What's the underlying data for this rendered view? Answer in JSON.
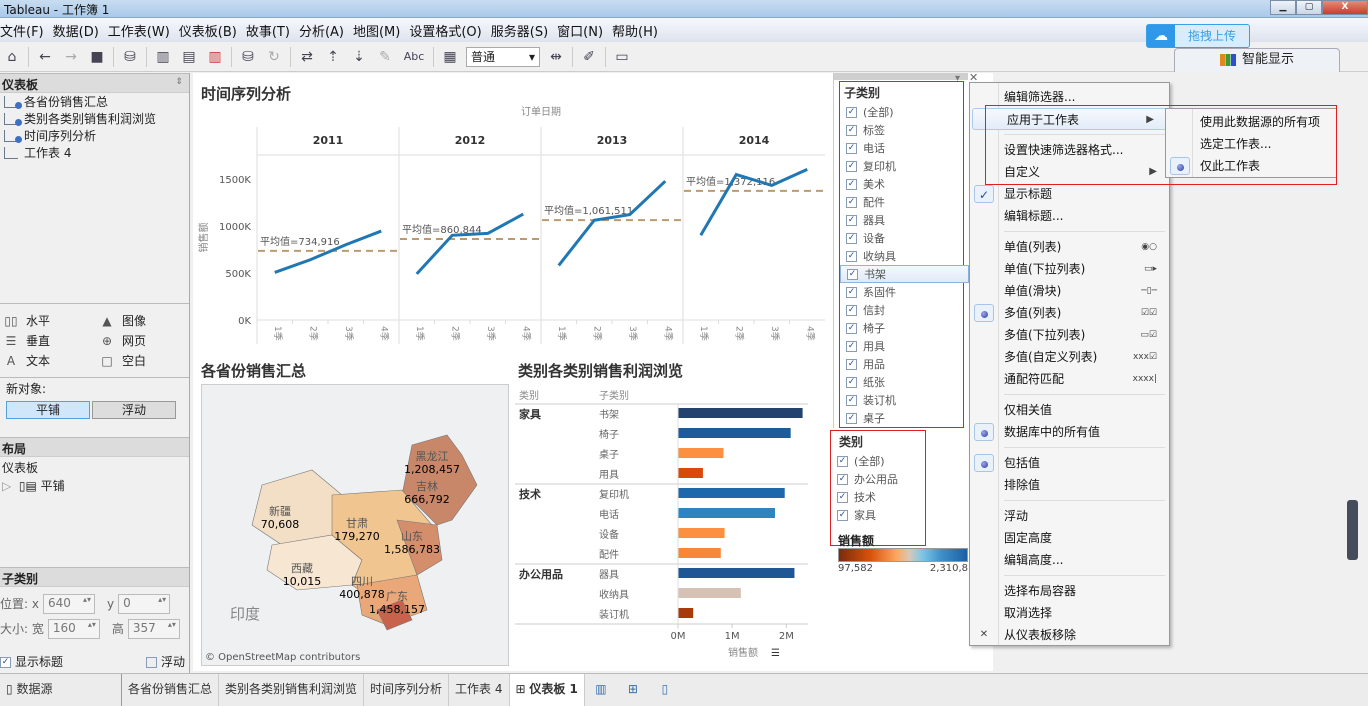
{
  "window": {
    "title": "Tableau - 工作簿 1"
  },
  "menubar": [
    "文件(F)",
    "数据(D)",
    "工作表(W)",
    "仪表板(B)",
    "故事(T)",
    "分析(A)",
    "地图(M)",
    "设置格式(O)",
    "服务器(S)",
    "窗口(N)",
    "帮助(H)"
  ],
  "toolbar": {
    "fit_select": "普通",
    "abc_label": "Abc"
  },
  "upload": {
    "label": "拖拽上传"
  },
  "smart_show": {
    "label": "智能显示"
  },
  "left_panel": {
    "dashboard_header": "仪表板",
    "sheets": [
      {
        "label": "各省份销售汇总",
        "used": true
      },
      {
        "label": "类别各类别销售利润浏览",
        "used": true
      },
      {
        "label": "时间序列分析",
        "used": true
      },
      {
        "label": "工作表 4",
        "used": false
      }
    ],
    "objects": [
      {
        "label": "水平",
        "icon": "horizontal-icon"
      },
      {
        "label": "图像",
        "icon": "image-icon"
      },
      {
        "label": "垂直",
        "icon": "vertical-icon"
      },
      {
        "label": "网页",
        "icon": "web-icon"
      },
      {
        "label": "文本",
        "icon": "text-icon"
      },
      {
        "label": "空白",
        "icon": "blank-icon"
      }
    ],
    "new_object_label": "新对象:",
    "tiled_label": "平铺",
    "floating_label": "浮动",
    "layout_header": "布局",
    "layout_root": "仪表板",
    "layout_child": "平铺",
    "selected_header": "子类别",
    "position_label": "位置: x",
    "x_value": "640",
    "y_label": "y",
    "y_value": "0",
    "size_label": "大小: 宽",
    "width_value": "160",
    "height_label": "高",
    "height_value": "357",
    "show_title_label": "显示标题",
    "show_title_checked": true,
    "floating_check_label": "浮动",
    "floating_checked": false
  },
  "time_series": {
    "title": "时间序列分析",
    "chart_data": {
      "type": "line",
      "title": "时间序列分析",
      "column_header": "订单日期",
      "ylabel": "销售额",
      "yticks": [
        "0K",
        "500K",
        "1000K",
        "1500K"
      ],
      "ylim": [
        0,
        1700000
      ],
      "panels": [
        {
          "year": "2011",
          "x": [
            "1季",
            "2季",
            "3季",
            "4季"
          ],
          "values": [
            505000,
            640000,
            800000,
            945000
          ],
          "avg_label": "平均值=734,916",
          "avg": 734916
        },
        {
          "year": "2012",
          "x": [
            "1季",
            "2季",
            "3季",
            "4季"
          ],
          "values": [
            490000,
            900000,
            920000,
            1125000
          ],
          "avg_label": "平均值=860,844",
          "avg": 860844
        },
        {
          "year": "2013",
          "x": [
            "1季",
            "2季",
            "3季",
            "4季"
          ],
          "values": [
            580000,
            1060000,
            1120000,
            1475000
          ],
          "avg_label": "平均值=1,061,511",
          "avg": 1061511
        },
        {
          "year": "2014",
          "x": [
            "1季",
            "2季",
            "3季",
            "4季"
          ],
          "values": [
            900000,
            1545000,
            1430000,
            1600000
          ],
          "avg_label": "平均值=1,372,116",
          "avg": 1372116
        }
      ],
      "line_color": "#1f77b4",
      "avg_color": "#b99b72"
    }
  },
  "map": {
    "title": "各省份销售汇总",
    "attribution": "© OpenStreetMap contributors",
    "country_label": "印度",
    "provinces": [
      {
        "name": "新疆",
        "value": "70,608"
      },
      {
        "name": "西藏",
        "value": "10,015"
      },
      {
        "name": "甘肃",
        "value": "179,270"
      },
      {
        "name": "四川",
        "value": "400,878"
      },
      {
        "name": "黑龙江",
        "value": "1,208,457"
      },
      {
        "name": "吉林",
        "value": "666,792"
      },
      {
        "name": "山东",
        "value": "1,586,783"
      },
      {
        "name": "广东",
        "value": "1,458,157"
      }
    ]
  },
  "category_bars": {
    "title": "类别各类别销售利润浏览",
    "chart_data": {
      "type": "bar",
      "orientation": "horizontal",
      "col_headers": [
        "类别",
        "子类别"
      ],
      "xlabel": "销售额",
      "xticks": [
        "0M",
        "1M",
        "2M"
      ],
      "xlim": [
        0,
        2400000
      ],
      "groups": [
        {
          "category": "家具",
          "items": [
            {
              "sub": "书架",
              "value": 2300000,
              "color": "#23436e"
            },
            {
              "sub": "椅子",
              "value": 2080000,
              "color": "#1d5b9b"
            },
            {
              "sub": "桌子",
              "value": 840000,
              "color": "#fc9040"
            },
            {
              "sub": "用具",
              "value": 460000,
              "color": "#d9490b"
            }
          ]
        },
        {
          "category": "技术",
          "items": [
            {
              "sub": "复印机",
              "value": 1970000,
              "color": "#1d68ab"
            },
            {
              "sub": "电话",
              "value": 1790000,
              "color": "#2f84c0"
            },
            {
              "sub": "设备",
              "value": 860000,
              "color": "#fc9040"
            },
            {
              "sub": "配件",
              "value": 790000,
              "color": "#f9873a"
            }
          ]
        },
        {
          "category": "办公用品",
          "items": [
            {
              "sub": "器具",
              "value": 2150000,
              "color": "#1f5794"
            },
            {
              "sub": "收纳具",
              "value": 1160000,
              "color": "#d6c2b4"
            },
            {
              "sub": "装订机",
              "value": 280000,
              "color": "#a93a0a"
            }
          ]
        }
      ]
    }
  },
  "subcategory_filter": {
    "title": "子类别",
    "items": [
      "(全部)",
      "标签",
      "电话",
      "复印机",
      "美术",
      "配件",
      "器具",
      "设备",
      "收纳具",
      "书架",
      "系固件",
      "信封",
      "椅子",
      "用具",
      "用品",
      "纸张",
      "装订机",
      "桌子"
    ],
    "highlighted": "书架"
  },
  "category_filter": {
    "title": "类别",
    "items": [
      "(全部)",
      "办公用品",
      "技术",
      "家具"
    ]
  },
  "color_legend": {
    "title": "销售额",
    "min": "97,582",
    "max": "2,310,8"
  },
  "context_menu": {
    "items": [
      {
        "label": "编辑筛选器...",
        "type": "item"
      },
      {
        "label": "应用于工作表",
        "type": "submenu",
        "hover": true
      },
      {
        "type": "sep"
      },
      {
        "label": "设置快速筛选器格式...",
        "type": "item"
      },
      {
        "label": "自定义",
        "type": "submenu"
      },
      {
        "label": "显示标题",
        "type": "check",
        "checked": true
      },
      {
        "label": "编辑标题...",
        "type": "item"
      },
      {
        "type": "sep"
      },
      {
        "label": "单值(列表)",
        "type": "radio",
        "glyph": "◉○"
      },
      {
        "label": "单值(下拉列表)",
        "type": "radio",
        "glyph": "▭▸"
      },
      {
        "label": "单值(滑块)",
        "type": "radio",
        "glyph": "─▯─"
      },
      {
        "label": "多值(列表)",
        "type": "radio",
        "checked": true,
        "glyph": "☑☑"
      },
      {
        "label": "多值(下拉列表)",
        "type": "radio",
        "glyph": "▭☑"
      },
      {
        "label": "多值(自定义列表)",
        "type": "radio",
        "glyph": "xxx☑"
      },
      {
        "label": "通配符匹配",
        "type": "radio",
        "glyph": "xxxx|"
      },
      {
        "type": "sep"
      },
      {
        "label": "仅相关值",
        "type": "radio"
      },
      {
        "label": "数据库中的所有值",
        "type": "radio",
        "checked": true
      },
      {
        "type": "sep"
      },
      {
        "label": "包括值",
        "type": "radio",
        "checked": true
      },
      {
        "label": "排除值",
        "type": "radio"
      },
      {
        "type": "sep"
      },
      {
        "label": "浮动",
        "type": "item"
      },
      {
        "label": "固定高度",
        "type": "item"
      },
      {
        "label": "编辑高度...",
        "type": "item"
      },
      {
        "type": "sep"
      },
      {
        "label": "选择布局容器",
        "type": "item"
      },
      {
        "label": "取消选择",
        "type": "item"
      },
      {
        "label": "从仪表板移除",
        "type": "remove"
      }
    ],
    "submenu": [
      {
        "label": "使用此数据源的所有项",
        "checked": false
      },
      {
        "label": "选定工作表...",
        "checked": false
      },
      {
        "label": "仅此工作表",
        "checked": true
      }
    ]
  },
  "bottom_tabs": {
    "datasource": "数据源",
    "tabs": [
      "各省份销售汇总",
      "类别各类别销售利润浏览",
      "时间序列分析",
      "工作表 4"
    ],
    "active": "仪表板 1"
  }
}
